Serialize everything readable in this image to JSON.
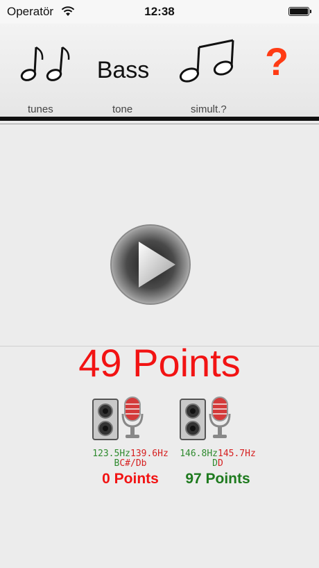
{
  "status_bar": {
    "carrier": "Operatör",
    "time": "12:38"
  },
  "toolbar": {
    "tone_label": "Bass",
    "help_label": "?",
    "tunes_caption": "tunes",
    "tone_caption": "tone",
    "simult_caption": "simult.?"
  },
  "main": {
    "total_points": "49 Points"
  },
  "players": [
    {
      "hz_left": "123.5Hz",
      "hz_right": "139.6Hz",
      "note_left": "B",
      "note_right": "C#/Db",
      "points": "0 Points"
    },
    {
      "hz_left": "146.8Hz",
      "hz_right": "145.7Hz",
      "note_left": "D",
      "note_right": "D",
      "points": "97 Points"
    }
  ],
  "colors": {
    "accent_red": "#f21313",
    "green": "#1e7a1e",
    "help": "#ff3b14"
  },
  "icons": [
    "wifi-icon",
    "battery-icon",
    "double-eighth-notes-icon",
    "beamed-notes-icon",
    "play-icon",
    "speaker-icon",
    "microphone-icon"
  ]
}
